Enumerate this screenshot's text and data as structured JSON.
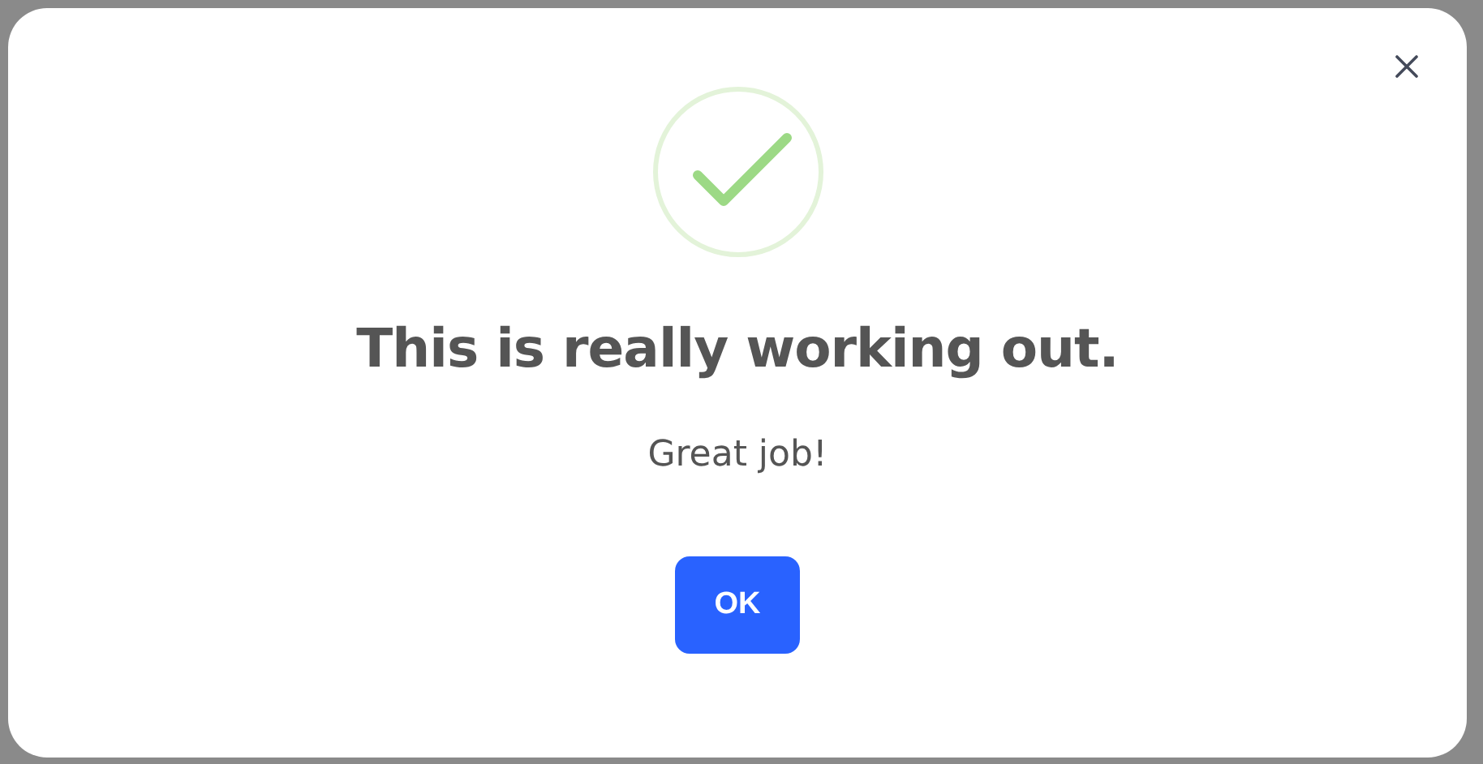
{
  "dialog": {
    "icon": {
      "kind": "success"
    },
    "title": "This is really working out.",
    "message": "Great job!",
    "buttons": [
      {
        "label": "OK"
      }
    ]
  }
}
